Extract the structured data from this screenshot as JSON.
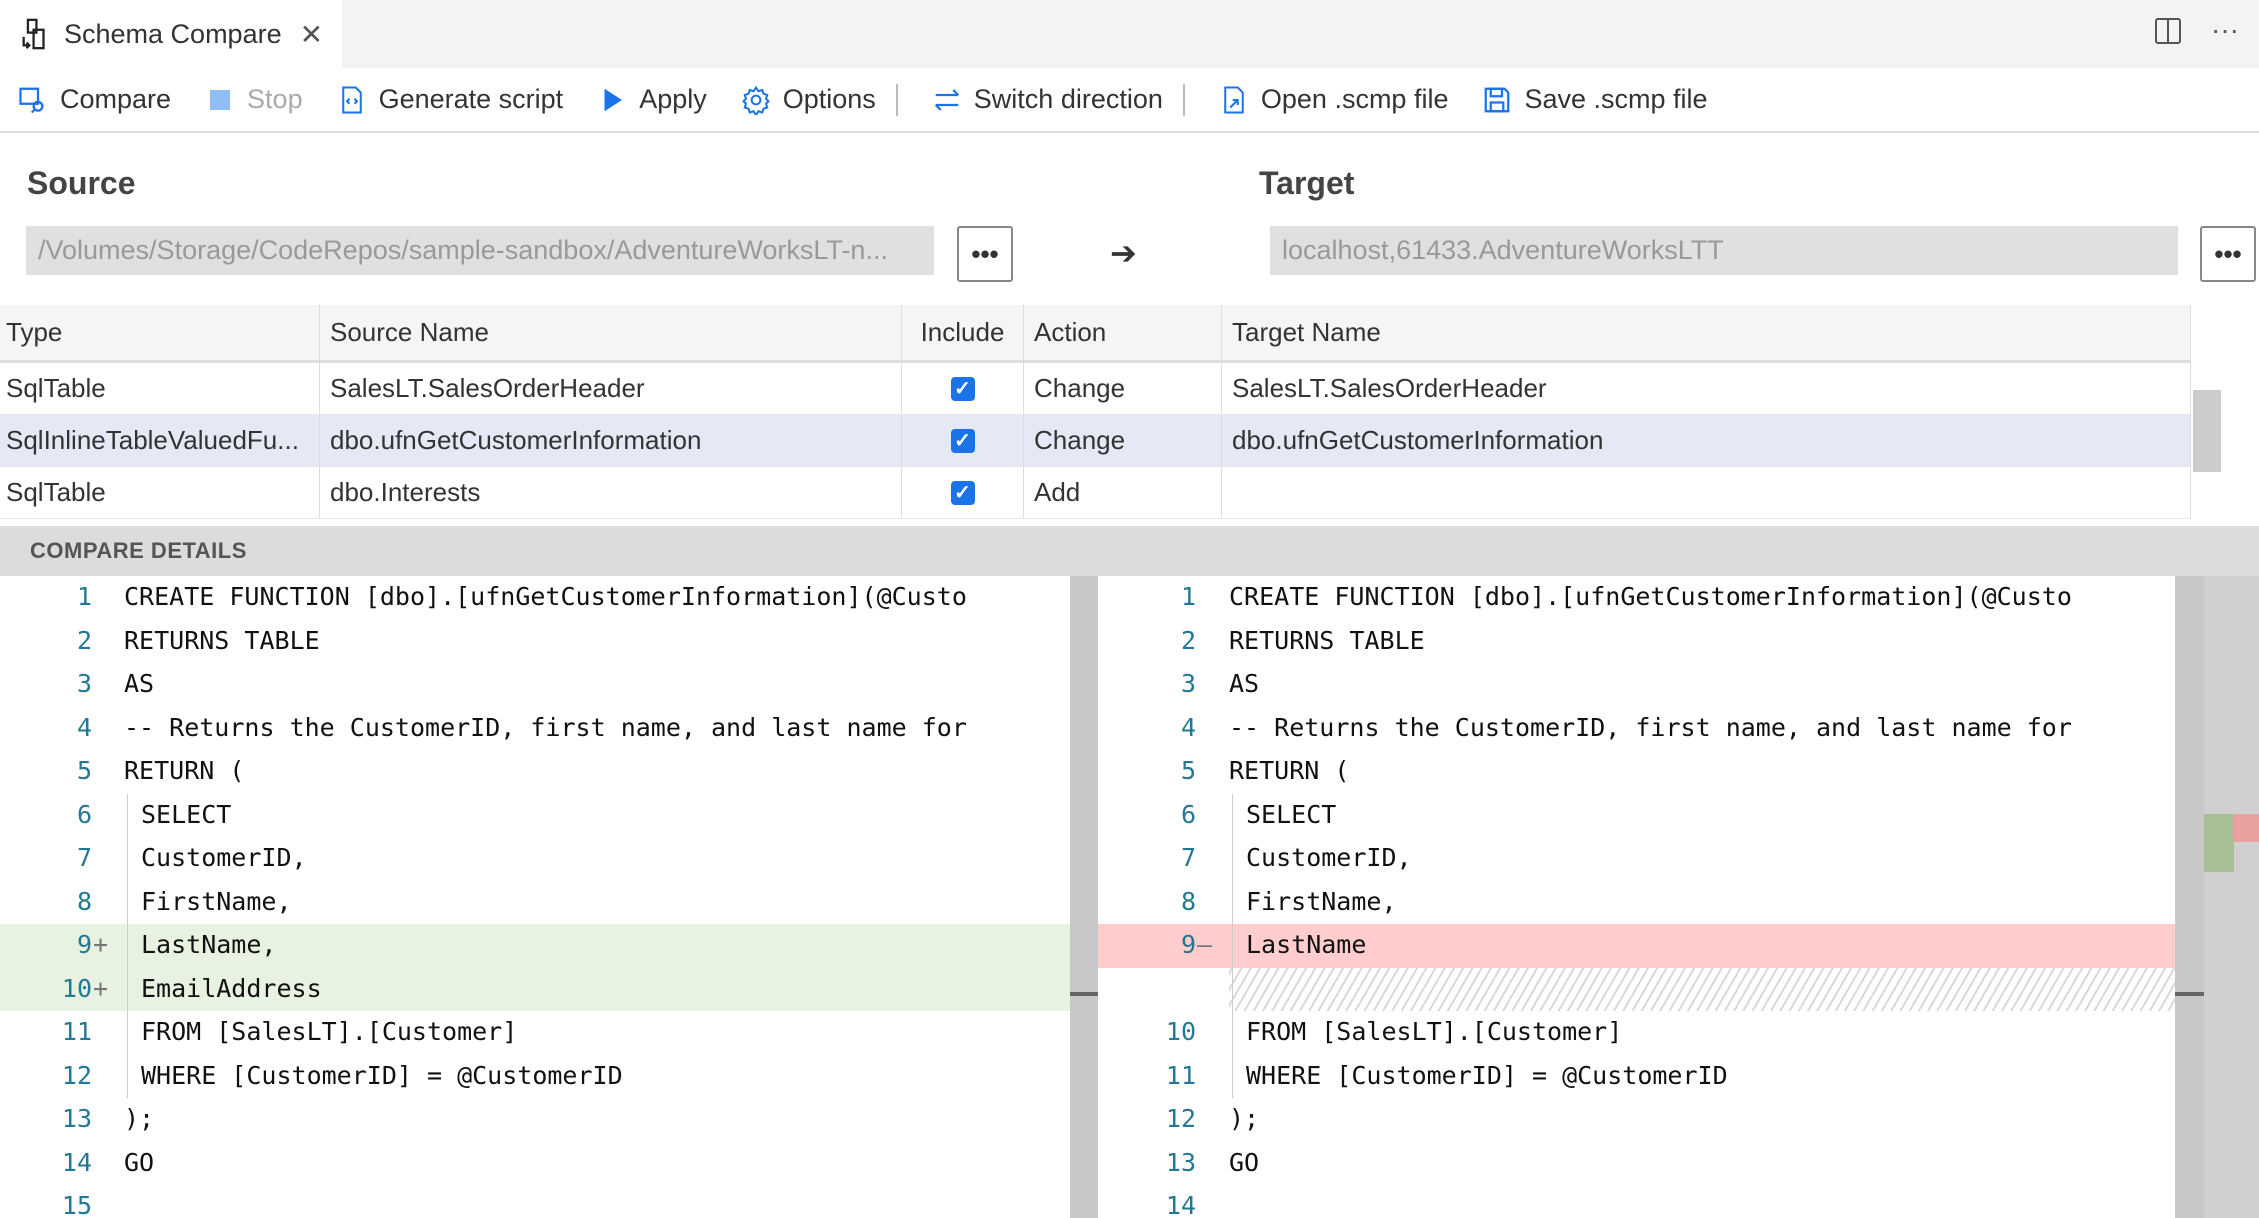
{
  "tab": {
    "title": "Schema Compare",
    "close": "✕",
    "icon": "schema-compare-icon"
  },
  "tab_actions": {
    "split": "▯▯",
    "more": "···"
  },
  "toolbar": [
    {
      "label": "Compare",
      "icon": "compare-icon",
      "enabled": true
    },
    {
      "label": "Stop",
      "icon": "stop-icon",
      "enabled": false
    },
    {
      "label": "Generate script",
      "icon": "script-icon",
      "enabled": true
    },
    {
      "label": "Apply",
      "icon": "play-icon",
      "enabled": true
    },
    {
      "label": "Options",
      "icon": "gear-icon",
      "enabled": true
    },
    {
      "label": "Switch direction",
      "icon": "switch-icon",
      "enabled": true
    },
    {
      "label": "Open .scmp file",
      "icon": "open-file-icon",
      "enabled": true
    },
    {
      "label": "Save .scmp file",
      "icon": "save-icon",
      "enabled": true
    }
  ],
  "source": {
    "label": "Source",
    "value": "/Volumes/Storage/CodeRepos/sample-sandbox/AdventureWorksLT-n...",
    "button": "•••"
  },
  "arrow": "➔",
  "target": {
    "label": "Target",
    "value": "localhost,61433.AdventureWorksLTT",
    "button": "•••"
  },
  "grid": {
    "columns": [
      "Type",
      "Source Name",
      "Include",
      "Action",
      "Target Name"
    ],
    "rows": [
      {
        "type": "SqlTable",
        "source": "SalesLT.SalesOrderHeader",
        "include": true,
        "action": "Change",
        "target": "SalesLT.SalesOrderHeader"
      },
      {
        "type": "SqlInlineTableValuedFu...",
        "source": "dbo.ufnGetCustomerInformation",
        "include": true,
        "action": "Change",
        "target": "dbo.ufnGetCustomerInformation",
        "selected": true
      },
      {
        "type": "SqlTable",
        "source": "dbo.Interests",
        "include": true,
        "action": "Add",
        "target": ""
      }
    ]
  },
  "details": {
    "title": "COMPARE DETAILS"
  },
  "colors": {
    "added": "#e8f2e0",
    "removed": "#ffcdcd",
    "accent": "#1a73e8",
    "line_number": "#237893"
  },
  "left_code": [
    {
      "n": "1",
      "t": "CREATE FUNCTION [dbo].[ufnGetCustomerInformation](@Custo",
      "i": 0
    },
    {
      "n": "2",
      "t": "RETURNS TABLE",
      "i": 0
    },
    {
      "n": "3",
      "t": "AS",
      "i": 0
    },
    {
      "n": "4",
      "t": "-- Returns the CustomerID, first name, and last name for",
      "i": 0
    },
    {
      "n": "5",
      "t": "RETURN (",
      "i": 0
    },
    {
      "n": "6",
      "t": "SELECT",
      "i": 1
    },
    {
      "n": "7",
      "t": "CustomerID,",
      "i": 1
    },
    {
      "n": "8",
      "t": "FirstName,",
      "i": 1
    },
    {
      "n": "9",
      "m": "+",
      "t": "LastName,",
      "i": 1,
      "k": "add"
    },
    {
      "n": "10",
      "m": "+",
      "t": "EmailAddress",
      "i": 1,
      "k": "add"
    },
    {
      "n": "11",
      "t": "FROM [SalesLT].[Customer]",
      "i": 1
    },
    {
      "n": "12",
      "t": "WHERE [CustomerID] = @CustomerID",
      "i": 1
    },
    {
      "n": "13",
      "t": ");",
      "i": 0
    },
    {
      "n": "14",
      "t": "GO",
      "i": 0
    },
    {
      "n": "15",
      "t": "",
      "i": 0
    }
  ],
  "right_code": [
    {
      "n": "1",
      "t": "CREATE FUNCTION [dbo].[ufnGetCustomerInformation](@Custo",
      "i": 0
    },
    {
      "n": "2",
      "t": "RETURNS TABLE",
      "i": 0
    },
    {
      "n": "3",
      "t": "AS",
      "i": 0
    },
    {
      "n": "4",
      "t": "-- Returns the CustomerID, first name, and last name for",
      "i": 0
    },
    {
      "n": "5",
      "t": "RETURN (",
      "i": 0
    },
    {
      "n": "6",
      "t": "SELECT",
      "i": 1
    },
    {
      "n": "7",
      "t": "CustomerID,",
      "i": 1
    },
    {
      "n": "8",
      "t": "FirstName,",
      "i": 1
    },
    {
      "n": "9",
      "m": "—",
      "t": "LastName",
      "i": 1,
      "k": "del"
    },
    {
      "n": "",
      "t": "",
      "i": 1,
      "k": "hatch"
    },
    {
      "n": "10",
      "t": "FROM [SalesLT].[Customer]",
      "i": 1
    },
    {
      "n": "11",
      "t": "WHERE [CustomerID] = @CustomerID",
      "i": 1
    },
    {
      "n": "12",
      "t": ");",
      "i": 0
    },
    {
      "n": "13",
      "t": "GO",
      "i": 0
    },
    {
      "n": "14",
      "t": "",
      "i": 0
    }
  ]
}
